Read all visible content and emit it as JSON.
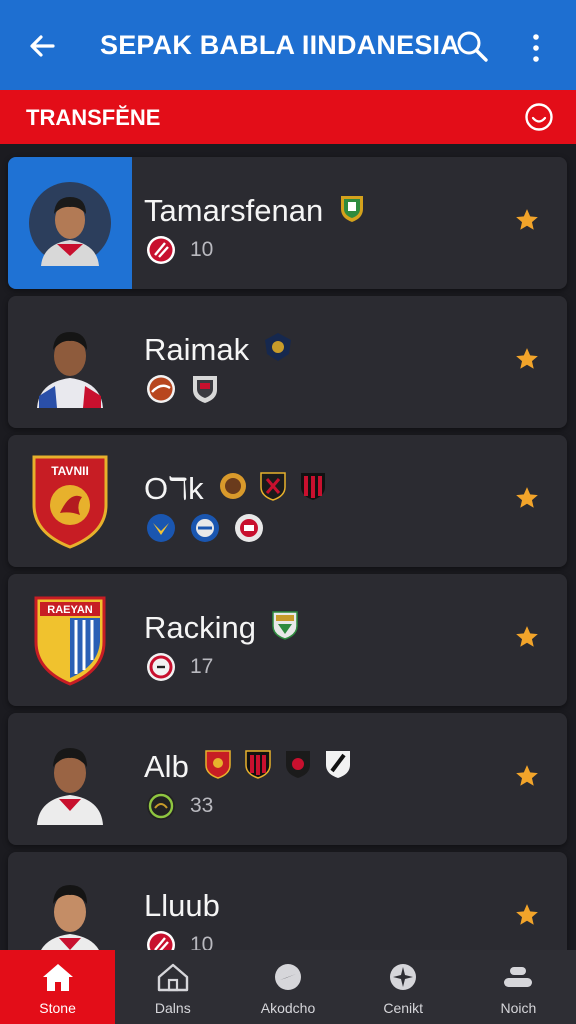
{
  "app": {
    "title": "SEPAK BABLA IINDANESIA",
    "back_icon": "arrow-left-icon",
    "search_icon": "search-icon",
    "menu_icon": "more-vertical-icon"
  },
  "section": {
    "label": "TRANSFĔNE",
    "icon": "refresh-circle-icon"
  },
  "colors": {
    "appbar": "#1e6fd1",
    "accent_red": "#e30d18",
    "card": "#2b2b31",
    "selected_thumb": "#1f72d4",
    "star": "#f2a42a"
  },
  "list": [
    {
      "name": "Tamarsfenan",
      "count": "10",
      "selected": true,
      "kind": "player"
    },
    {
      "name": "Raimak",
      "count": "",
      "selected": false,
      "kind": "player"
    },
    {
      "name": "Oℸk",
      "count": "",
      "selected": false,
      "kind": "crest",
      "crest_text": "TAVNII"
    },
    {
      "name": "Racking",
      "count": "17",
      "selected": false,
      "kind": "crest",
      "crest_text": "RAEYAN"
    },
    {
      "name": "Alb",
      "count": "33",
      "selected": false,
      "kind": "player"
    },
    {
      "name": "Lluub",
      "count": "10",
      "selected": false,
      "kind": "player"
    }
  ],
  "bottom_nav": [
    {
      "label": "Stone",
      "icon": "home-icon",
      "active": true
    },
    {
      "label": "Dalns",
      "icon": "house-outline-icon",
      "active": false
    },
    {
      "label": "Akodcho",
      "icon": "compass-icon",
      "active": false
    },
    {
      "label": "Cenikt",
      "icon": "star-burst-icon",
      "active": false
    },
    {
      "label": "Noich",
      "icon": "profile-icon",
      "active": false
    }
  ]
}
